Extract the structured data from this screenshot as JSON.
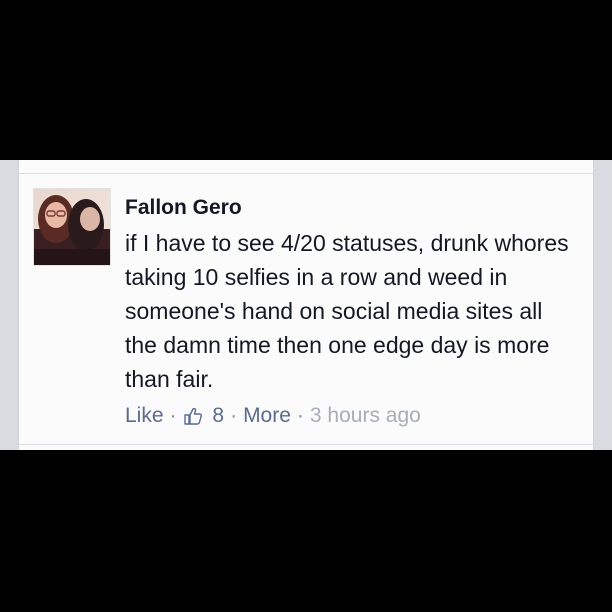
{
  "post": {
    "author": "Fallon Gero",
    "text": "if I have to see 4/20 statuses, drunk whores taking 10 selfies in a row and weed in someone's hand on social media sites all the damn time then one edge day is more than fair.",
    "like_label": "Like",
    "separator": "·",
    "like_count": "8",
    "more_label": "More",
    "timestamp": "3 hours ago"
  },
  "icons": {
    "like_count_icon": "thumbs-up-icon",
    "avatar": "avatar-photo"
  },
  "colors": {
    "background": "#000000",
    "card": "#fbfbfb",
    "text": "#141823",
    "link": "#5b6b8f",
    "muted": "#a8adb5"
  }
}
